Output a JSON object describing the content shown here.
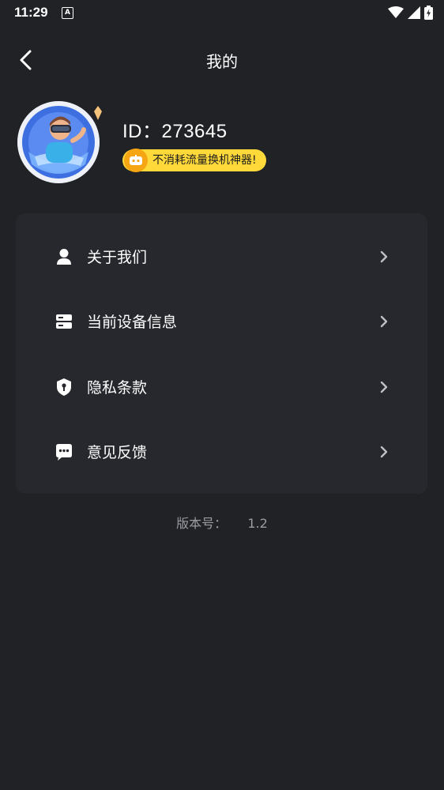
{
  "status_bar": {
    "time": "11:29",
    "notification_icon": "a-notification-icon",
    "icons": [
      "wifi-icon",
      "signal-icon",
      "battery-charging-icon"
    ]
  },
  "header": {
    "title": "我的",
    "back_icon": "chevron-left-icon"
  },
  "profile": {
    "id_text": "ID：273645",
    "promo_text": "不消耗流量换机神器!",
    "avatar": "vr-user-avatar"
  },
  "menu": {
    "items": [
      {
        "label": "关于我们",
        "icon": "person-icon"
      },
      {
        "label": "当前设备信息",
        "icon": "server-icon"
      },
      {
        "label": "隐私条款",
        "icon": "shield-lock-icon"
      },
      {
        "label": "意见反馈",
        "icon": "chat-dots-icon"
      }
    ]
  },
  "footer": {
    "version_label": "版本号：",
    "version_value": "1.2"
  },
  "colors": {
    "background": "#202226",
    "card": "#26282d",
    "badge": "#ffd93a",
    "badge_icon": "#f6a612",
    "muted_text": "#9a9ca2"
  }
}
